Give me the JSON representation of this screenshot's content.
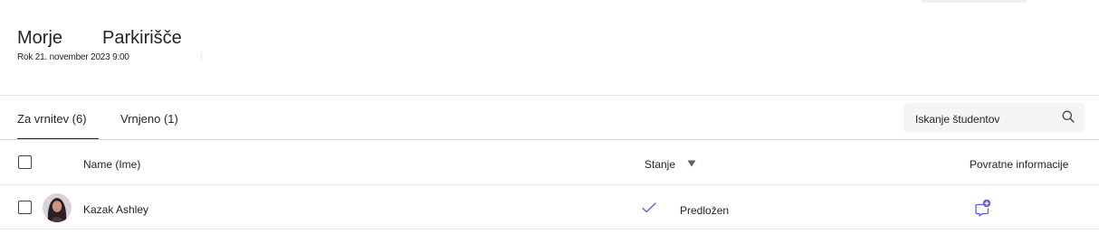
{
  "header": {
    "assignment_parts": [
      "Morje",
      "Parkirišče"
    ],
    "due": "Rok 21. november 2023 9:00"
  },
  "tabs": [
    {
      "label": "Za vrnitev (6)",
      "active": true
    },
    {
      "label": "Vrnjeno (1)",
      "active": false
    }
  ],
  "search": {
    "placeholder": "Iskanje študentov"
  },
  "table": {
    "columns": {
      "name": "Name (Ime)",
      "status": "Stanje",
      "feedback": "Povratne informacije"
    },
    "rows": [
      {
        "name": "Kazak Ashley",
        "status": "Predložen"
      }
    ]
  },
  "icons": {
    "search": "search-icon",
    "sort": "sort-down-icon",
    "check": "checkmark-icon",
    "feedback": "add-feedback-icon"
  },
  "colors": {
    "accent": "#5b5fc7",
    "text": "#242424",
    "divider": "#e0e0e0"
  }
}
